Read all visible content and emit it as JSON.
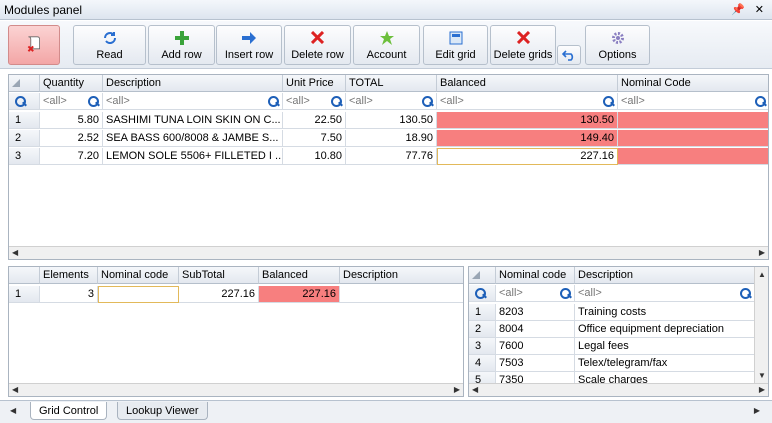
{
  "panel": {
    "title": "Modules panel",
    "pin_icon": "pin-icon",
    "close_icon": "close-icon"
  },
  "toolbar": {
    "buttons": [
      {
        "label": "",
        "icon": "scroll-delete-icon"
      },
      {
        "label": "Read",
        "icon": "refresh-icon"
      },
      {
        "label": "Add row",
        "icon": "plus-icon"
      },
      {
        "label": "Insert row",
        "icon": "arrow-right-icon"
      },
      {
        "label": "Delete row",
        "icon": "x-icon"
      },
      {
        "label": "Account",
        "icon": "star-icon"
      },
      {
        "label": "Edit grid",
        "icon": "grid-edit-icon"
      },
      {
        "label": "Delete grids",
        "icon": "x-icon"
      },
      {
        "label": "",
        "icon": "undo-icon"
      },
      {
        "label": "Options",
        "icon": "gear-icon"
      }
    ]
  },
  "main_grid": {
    "columns": [
      "Quantity",
      "Description",
      "Unit Price",
      "TOTAL",
      "Balanced",
      "Nominal Code"
    ],
    "filter": "<all>",
    "rows": [
      {
        "n": "1",
        "qty": "5.80",
        "desc": "SASHIMI TUNA LOIN SKIN ON C...",
        "price": "22.50",
        "total": "130.50",
        "balanced": "130.50",
        "code": ""
      },
      {
        "n": "2",
        "qty": "2.52",
        "desc": "SEA BASS 600/8008 & JAMBE S...",
        "price": "7.50",
        "total": "18.90",
        "balanced": "149.40",
        "code": ""
      },
      {
        "n": "3",
        "qty": "7.20",
        "desc": "LEMON SOLE 5506+ FILLETED I ...",
        "price": "10.80",
        "total": "77.76",
        "balanced": "227.16",
        "code": ""
      }
    ]
  },
  "summary_grid": {
    "columns": [
      "Elements",
      "Nominal code",
      "SubTotal",
      "Balanced",
      "Description"
    ],
    "rows": [
      {
        "n": "1",
        "elements": "3",
        "code": "",
        "subtotal": "227.16",
        "balanced": "227.16",
        "desc": ""
      }
    ]
  },
  "lookup_grid": {
    "columns": [
      "Nominal code",
      "Description"
    ],
    "filter": "<all>",
    "rows": [
      {
        "n": "1",
        "code": "8203",
        "desc": "Training costs"
      },
      {
        "n": "2",
        "code": "8004",
        "desc": "Office equipment depreciation"
      },
      {
        "n": "3",
        "code": "7600",
        "desc": "Legal fees"
      },
      {
        "n": "4",
        "code": "7503",
        "desc": "Telex/telegram/fax"
      },
      {
        "n": "5",
        "code": "7350",
        "desc": "Scale charges"
      }
    ]
  },
  "tabs": [
    "Grid Control",
    "Lookup Viewer"
  ],
  "colors": {
    "balanced_red": "#f77f7f",
    "selected_outline": "#e2b95a",
    "accent_blue": "#1d5fb8"
  }
}
